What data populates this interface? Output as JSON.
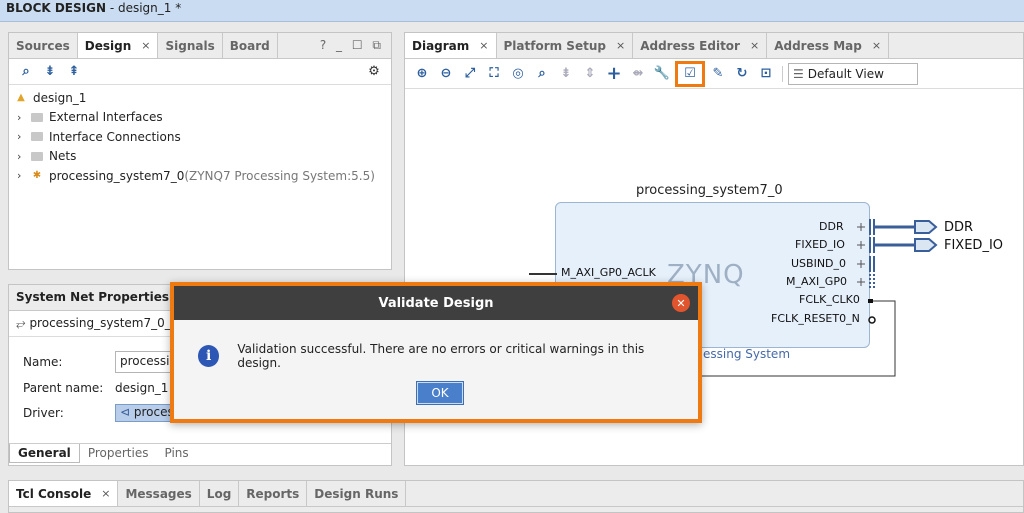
{
  "window": {
    "title_bold": "BLOCK DESIGN",
    "title_rest": " - design_1 *"
  },
  "left_panel": {
    "tabs": [
      "Sources",
      "Design",
      "Signals",
      "Board"
    ],
    "tab_close": "×",
    "controls": "? _ ☐ ⧉",
    "tree": {
      "root": "design_1",
      "items": [
        {
          "label": "External Interfaces"
        },
        {
          "label": "Interface Connections"
        },
        {
          "label": "Nets"
        },
        {
          "label": "processing_system7_0",
          "suffix": " (ZYNQ7 Processing System:5.5)"
        }
      ]
    }
  },
  "properties_panel": {
    "title": "System Net Properties",
    "object": "processing_system7_0_F",
    "name_label": "Name:",
    "name_value": "processin",
    "parent_label": "Parent name:",
    "parent_value": "design_1",
    "driver_label": "Driver:",
    "driver_value": "proces",
    "tabs": [
      "General",
      "Properties",
      "Pins"
    ]
  },
  "diagram_panel": {
    "tabs": [
      "Diagram",
      "Platform Setup",
      "Address Editor",
      "Address Map"
    ],
    "view_select": "Default View",
    "ip": {
      "title": "processing_system7_0",
      "logo": "ZYNQ",
      "subtitle": "essing System",
      "left_ports": [
        "M_AXI_GP0_ACLK"
      ],
      "right_ports": [
        "DDR",
        "FIXED_IO",
        "USBIND_0",
        "M_AXI_GP0",
        "FCLK_CLK0",
        "FCLK_RESET0_N"
      ],
      "external_ports": [
        "DDR",
        "FIXED_IO"
      ]
    }
  },
  "bottom_tabs": [
    "Tcl Console",
    "Messages",
    "Log",
    "Reports",
    "Design Runs"
  ],
  "dialog": {
    "title": "Validate Design",
    "message": "Validation successful. There are no errors or critical warnings in this design.",
    "ok": "OK"
  },
  "colors": {
    "accent": "#f07a12",
    "title_bar": "#c9dcf2",
    "ip_fill": "#e6f0fb",
    "info": "#2c57b4"
  }
}
